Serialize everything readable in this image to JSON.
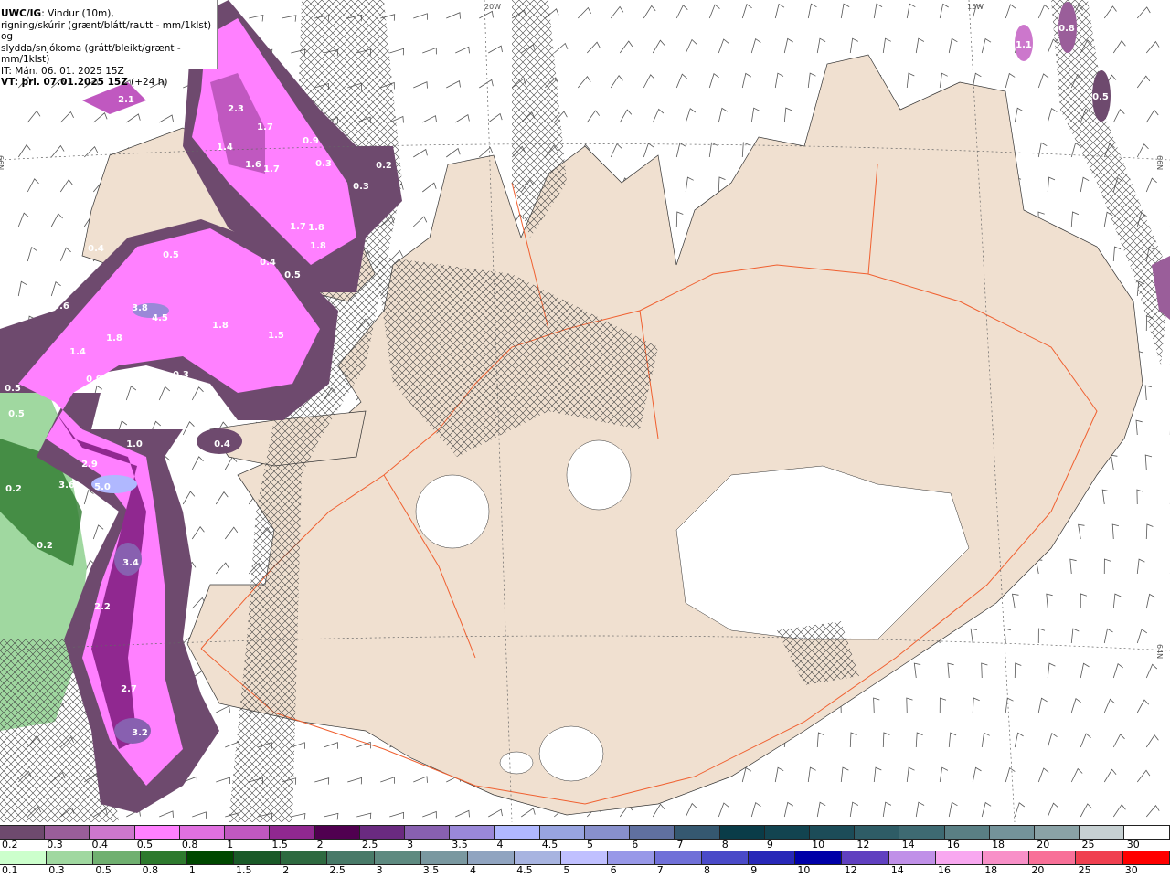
{
  "header": {
    "model": "UWC/IG",
    "line1_rest": ": Vindur (10m),",
    "line2": "rigning/skúrir (grænt/blátt/rautt - mm/1klst) og",
    "line3": "slydda/snjókoma (grátt/bleikt/grænt - mm/1klst)",
    "init_time": "IT: Mán. 06. 01. 2025 15Z",
    "valid_label": "VT: þri. 07.01.2025 15Z",
    "lead": "(+24 h)"
  },
  "map": {
    "land_color": "#f0e0d0",
    "road_color": "#f06030",
    "glacier_color": "#ffffff",
    "axis_labels": [
      "20W",
      "15W",
      "66N",
      "66N",
      "64N"
    ],
    "value_labels": [
      "2.1",
      "2.3",
      "1.7",
      "1.4",
      "1.6",
      "1.7",
      "0.9",
      "0.3",
      "0.2",
      "0.3",
      "1.7",
      "1.8",
      "1.8",
      "0.4",
      "0.5",
      "0.5",
      "0.4",
      "0.5",
      "0.6",
      "3.8",
      "4.5",
      "1.8",
      "1.5",
      "1.8",
      "1.4",
      "0.3",
      "0.9",
      "0.5",
      "0.5",
      "1.0",
      "0.4",
      "2.9",
      "3.6",
      "5.0",
      "0.2",
      "0.2",
      "3.4",
      "2.2",
      "2.7",
      "3.2",
      "1.1",
      "0.8",
      "0.5"
    ]
  },
  "legend_snow": {
    "labels": [
      "0.2",
      "0.3",
      "0.4",
      "0.5",
      "0.8",
      "1",
      "1.5",
      "2",
      "2.5",
      "3",
      "3.5",
      "4",
      "4.5",
      "5",
      "6",
      "7",
      "8",
      "9",
      "10",
      "12",
      "14",
      "16",
      "18",
      "20",
      "25",
      "30"
    ],
    "colors": [
      "#6e4a6e",
      "#9a5e9a",
      "#cc77cc",
      "#ff80ff",
      "#e070e0",
      "#c058c0",
      "#902890",
      "#500050",
      "#6a2a80",
      "#8860b0",
      "#9a88d8",
      "#b0b8ff",
      "#98a4e0",
      "#8890cc",
      "#6070a0",
      "#355870",
      "#0a3c48",
      "#124450",
      "#1c4c58",
      "#2e5c66",
      "#3e6a72",
      "#5a7f84",
      "#74939a",
      "#8aa2a6",
      "#c6d0d2",
      "#ffffff"
    ]
  },
  "legend_rain": {
    "labels": [
      "0.1",
      "0.3",
      "0.5",
      "0.8",
      "1",
      "1.5",
      "2",
      "2.5",
      "3",
      "3.5",
      "4",
      "4.5",
      "5",
      "6",
      "7",
      "8",
      "9",
      "10",
      "12",
      "14",
      "16",
      "18",
      "20",
      "25",
      "30"
    ],
    "colors": [
      "#ccffcc",
      "#a0d8a0",
      "#70b070",
      "#2e7a2e",
      "#004800",
      "#1a5a28",
      "#2e6a40",
      "#487a68",
      "#5e8a80",
      "#7a98a0",
      "#90a4c0",
      "#a8b4e0",
      "#c0c0ff",
      "#9898e8",
      "#7070d8",
      "#4a4ac8",
      "#2828b8",
      "#0000a8",
      "#6040c0",
      "#c090e8",
      "#f8a8f0",
      "#f890c8",
      "#f87098",
      "#f04050",
      "#ff0000"
    ]
  }
}
